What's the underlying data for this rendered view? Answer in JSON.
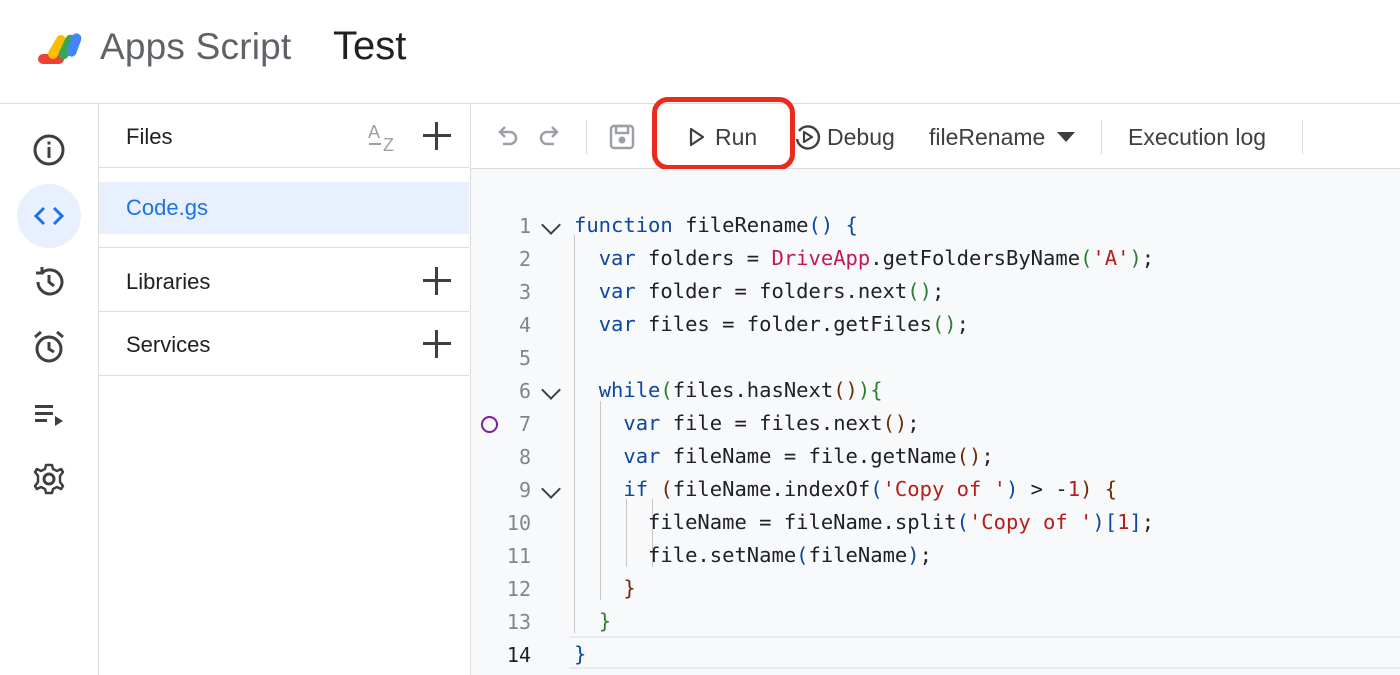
{
  "header": {
    "app_title": "Apps Script",
    "project_title": "Test"
  },
  "rail": {
    "items": [
      {
        "name": "overview",
        "icon": "info-icon",
        "active": false
      },
      {
        "name": "editor",
        "icon": "code-icon",
        "active": true
      },
      {
        "name": "history",
        "icon": "history-icon",
        "active": false
      },
      {
        "name": "triggers",
        "icon": "alarm-icon",
        "active": false
      },
      {
        "name": "executions",
        "icon": "executions-icon",
        "active": false
      },
      {
        "name": "settings",
        "icon": "gear-icon",
        "active": false
      }
    ]
  },
  "files_panel": {
    "files_label": "Files",
    "sort_icon": "az-sort-icon",
    "files": [
      {
        "name": "Code.gs",
        "selected": true
      }
    ],
    "libraries_label": "Libraries",
    "services_label": "Services"
  },
  "toolbar": {
    "run_label": "Run",
    "debug_label": "Debug",
    "function_name": "fileRename",
    "execution_log_label": "Execution log",
    "highlight_color": "#ea2a1b"
  },
  "editor": {
    "current_line": 14,
    "breakpoint_line": 7,
    "fold_lines": [
      1,
      6,
      9
    ],
    "lines": [
      "function fileRename() {",
      "  var folders = DriveApp.getFoldersByName('A');",
      "  var folder = folders.next();",
      "  var files = folder.getFiles();",
      "",
      "  while(files.hasNext()){",
      "    var file = files.next();",
      "    var fileName = file.getName();",
      "    if (fileName.indexOf('Copy of ') > -1) {",
      "      fileName = fileName.split('Copy of ')[1];",
      "      file.setName(fileName);",
      "    }",
      "  }",
      "}"
    ]
  }
}
